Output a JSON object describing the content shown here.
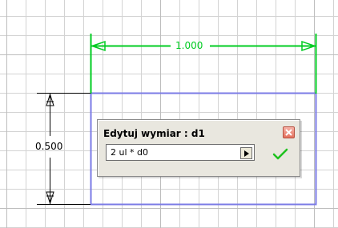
{
  "dimensions": {
    "horizontal": {
      "value_text": "1.000",
      "color": "#00cc22"
    },
    "vertical": {
      "value_text": "0.500",
      "color": "#000000"
    }
  },
  "sketch": {
    "rectangle_color": "#7b7be6",
    "grid_color": "#d3d3d3"
  },
  "edit_dialog": {
    "title": "Edytuj wymiar : d1",
    "input_value": "2 ul * d0",
    "close_icon": "close-icon",
    "dropdown_icon": "triangle-right-icon",
    "accept_icon": "checkmark-icon",
    "accept_color": "#1fc21f"
  }
}
